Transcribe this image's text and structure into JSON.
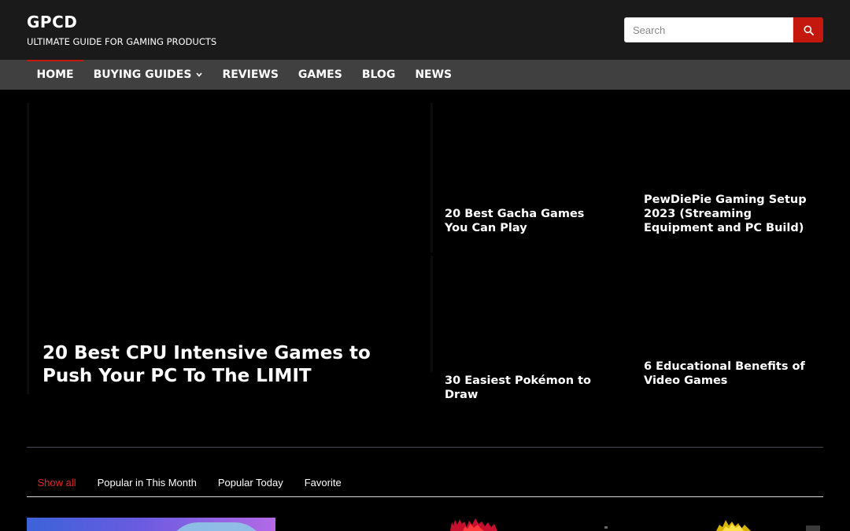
{
  "site": {
    "title": "GPCD",
    "tagline": "ULTIMATE GUIDE FOR GAMING PRODUCTS"
  },
  "search": {
    "placeholder": "Search",
    "value": "",
    "icon": "search-icon",
    "button_color": "#c4180e"
  },
  "nav": {
    "items": [
      {
        "label": "HOME",
        "active": true
      },
      {
        "label": "BUYING GUIDES",
        "has_dropdown": true,
        "icon": "chevron-down-icon"
      },
      {
        "label": "REVIEWS"
      },
      {
        "label": "GAMES"
      },
      {
        "label": "BLOG"
      },
      {
        "label": "NEWS"
      }
    ],
    "active_color": "#c4180e"
  },
  "featured": {
    "main": {
      "title": "20 Best CPU Intensive Games to Push Your PC To The LIMIT"
    },
    "items": [
      {
        "title": "20 Best Gacha Games You Can Play"
      },
      {
        "title": "PewDiePie Gaming Setup 2023 (Streaming Equipment and PC Build)"
      },
      {
        "title": "30 Easiest Pokémon to Draw"
      },
      {
        "title": "6 Educational Benefits of Video Games"
      }
    ]
  },
  "tabs": {
    "items": [
      {
        "label": "Show all",
        "active": true
      },
      {
        "label": "Popular in This Month"
      },
      {
        "label": "Popular Today"
      },
      {
        "label": "Favorite"
      }
    ],
    "active_color": "#e0261d"
  },
  "colors": {
    "header_bg": "#1a1a1a",
    "nav_bg": "#404040",
    "accent": "#c4180e",
    "page_bg": "#000000"
  }
}
